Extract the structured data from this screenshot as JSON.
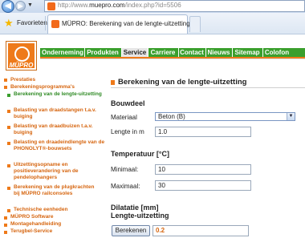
{
  "browser": {
    "address": {
      "prefix": "http://www.",
      "domain": "muepro.com",
      "suffix": "/index.php?id=5506"
    },
    "favorites_label": "Favorieten",
    "tab_title": "MÜPRO: Berekening van de lengte-uitzetting"
  },
  "logo": {
    "text": "MÜPRO",
    "brand_color": "#ee7a1a"
  },
  "menu": {
    "items": [
      {
        "label": "Onderneming"
      },
      {
        "label": "Produkten"
      },
      {
        "label": "Service"
      },
      {
        "label": "Carriere"
      },
      {
        "label": "Contact"
      },
      {
        "label": "Nieuws"
      },
      {
        "label": "Sitemap"
      },
      {
        "label": "Colofon"
      }
    ],
    "active": "Service",
    "color": "#3a9f2d"
  },
  "sidebar": {
    "items": [
      {
        "label": "Prestaties",
        "level": "top"
      },
      {
        "label": "Berekeningsprogramma's",
        "level": "top"
      },
      {
        "label": "Berekening van de lengte-uitzetting",
        "level": "sub"
      },
      {
        "label": "Belasting van draadstangen t.a.v. buiging",
        "level": "sub"
      },
      {
        "label": "Belasting van draadbuizen t.a.v. buiging",
        "level": "sub"
      },
      {
        "label": "Belasting en draadeindlengte van de PHONOLYT®-bouwsets",
        "level": "sub"
      },
      {
        "label": "Uitzettingsopname en positieverandering van de pendelophangers",
        "level": "sub"
      },
      {
        "label": "Berekening van de plugkrachten bij MÜPRO rail­consoles",
        "level": "sub"
      },
      {
        "label": "Technische eenheden",
        "level": "sub"
      },
      {
        "label": "MÜPRO Software",
        "level": "top"
      },
      {
        "label": "Montagehandleiding",
        "level": "top"
      },
      {
        "label": "Terugbel-Service",
        "level": "top"
      }
    ]
  },
  "main": {
    "heading": "Berekening van de lengte-uitzetting",
    "section_bouwdeel": "Bouwdeel",
    "materiaal_label": "Materiaal",
    "materiaal_value": "Beton (B)",
    "lengte_label": "Lengte in m",
    "lengte_value": "1.0",
    "section_temp": "Temperatuur [°C]",
    "min_label": "Minimaal:",
    "min_value": "10",
    "max_label": "Maximaal:",
    "max_value": "30",
    "result_title_1": "Dilatatie [mm]",
    "result_title_2": "Lengte-uitzetting",
    "button_label": "Berekenen",
    "result_value": "0.2"
  }
}
